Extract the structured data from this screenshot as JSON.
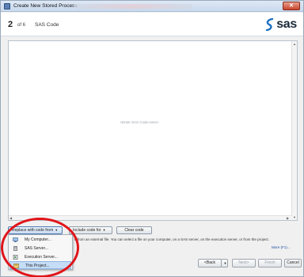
{
  "window": {
    "title": "Create New Stored Process"
  },
  "header": {
    "step": "2",
    "of": "of 6",
    "title": "SAS Code",
    "logo": "sas"
  },
  "editor": {
    "placeholder": "<Enter SAS Code Here>"
  },
  "toolbar": {
    "replace_label": "Replace with code from",
    "include_label": "Include code for",
    "clear_label": "Clear code"
  },
  "menu": {
    "items": [
      {
        "label": "My Computer...",
        "icon": "computer-icon"
      },
      {
        "label": "SAS Server...",
        "icon": "server-icon"
      },
      {
        "label": "Execution Server...",
        "icon": "execution-server-icon"
      },
      {
        "label": "This Project...",
        "icon": "project-icon",
        "selected": true
      }
    ]
  },
  "info": {
    "text": "e from an external file. You can select a file on your computer, on a SAS server, on the execution server, or from the project.",
    "more": "More (F1)..."
  },
  "nav": {
    "back": "<Back",
    "next": "Next>",
    "finish": "Finish",
    "cancel": "Cancel"
  },
  "colors": {
    "annotation": "#e0141a",
    "accent": "#4f79b0"
  }
}
